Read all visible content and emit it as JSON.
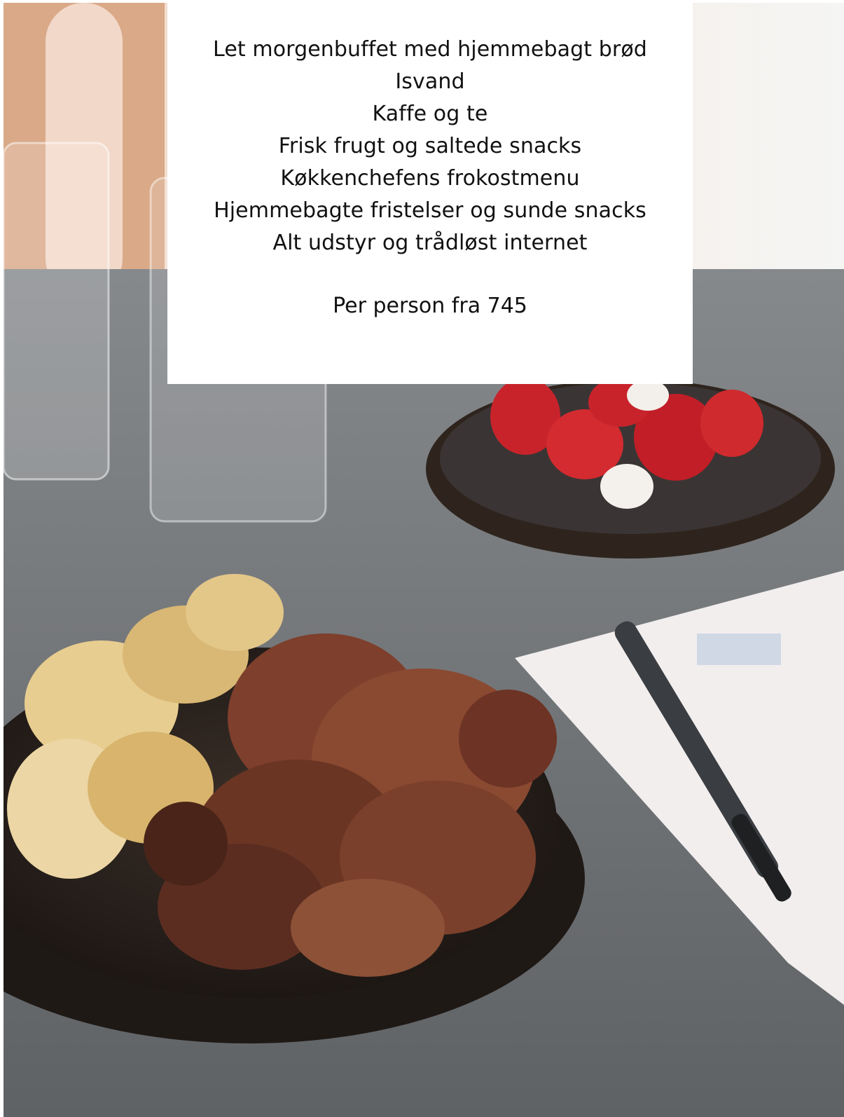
{
  "menu": {
    "items": [
      "Let morgenbuffet med hjemmebagt brød",
      "Isvand",
      "Kaffe og te",
      "Frisk frugt og saltede snacks",
      "Køkkenchefens frokostmenu",
      "Hjemmebagte fristelser og sunde snacks",
      "Alt udstyr og trådløst internet"
    ],
    "price": "Per person fra 745"
  },
  "colors": {
    "table": "#6f7275",
    "plate": "#2e241d",
    "strawberry": "#c8232b",
    "paper": "#f2eeee"
  }
}
